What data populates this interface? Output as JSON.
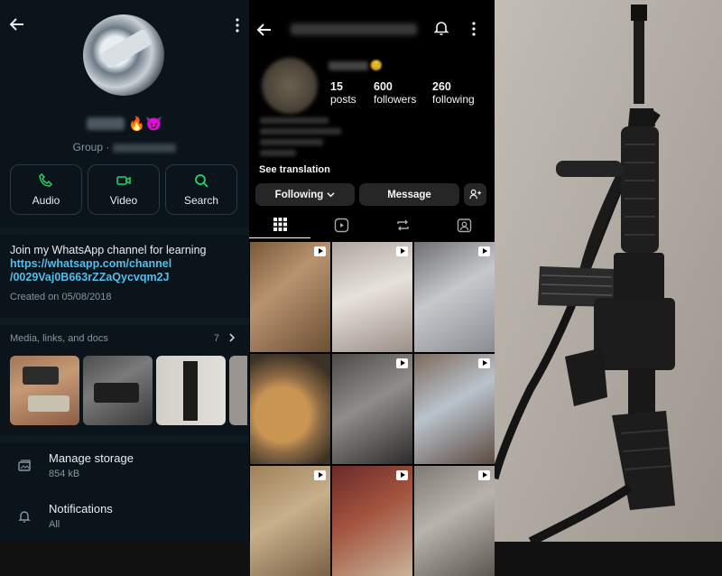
{
  "whatsapp": {
    "group_label": "Group ·",
    "name_emoji": "🔥😈",
    "actions": [
      {
        "label": "Audio",
        "icon": "phone-icon"
      },
      {
        "label": "Video",
        "icon": "video-icon"
      },
      {
        "label": "Search",
        "icon": "search-icon"
      }
    ],
    "description_text": "Join my WhatsApp channel for learning",
    "description_link_1": "https://whatsapp.com/channel",
    "description_link_2": "/0029Vaj0B663rZZaQycvqm2J",
    "created": "Created on 05/08/2018",
    "media_header": "Media, links, and docs",
    "media_count": "7",
    "manage_storage": {
      "title": "Manage storage",
      "subtitle": "854 kB",
      "icon": "storage-icon"
    },
    "notifications": {
      "title": "Notifications",
      "subtitle": "All",
      "icon": "bell-icon"
    },
    "accent_color": "#25d366",
    "link_color": "#53bdeb"
  },
  "instagram": {
    "stats": [
      {
        "value": "15",
        "label": "posts"
      },
      {
        "value": "600",
        "label": "followers"
      },
      {
        "value": "260",
        "label": "following"
      }
    ],
    "see_translation": "See translation",
    "following_button": "Following",
    "message_button": "Message",
    "tabs": [
      {
        "icon": "grid-icon"
      },
      {
        "icon": "reels-icon"
      },
      {
        "icon": "repost-icon"
      },
      {
        "icon": "tagged-icon"
      }
    ]
  },
  "photo": {
    "subject": "black rifle with sling leaning against a concrete wall"
  }
}
